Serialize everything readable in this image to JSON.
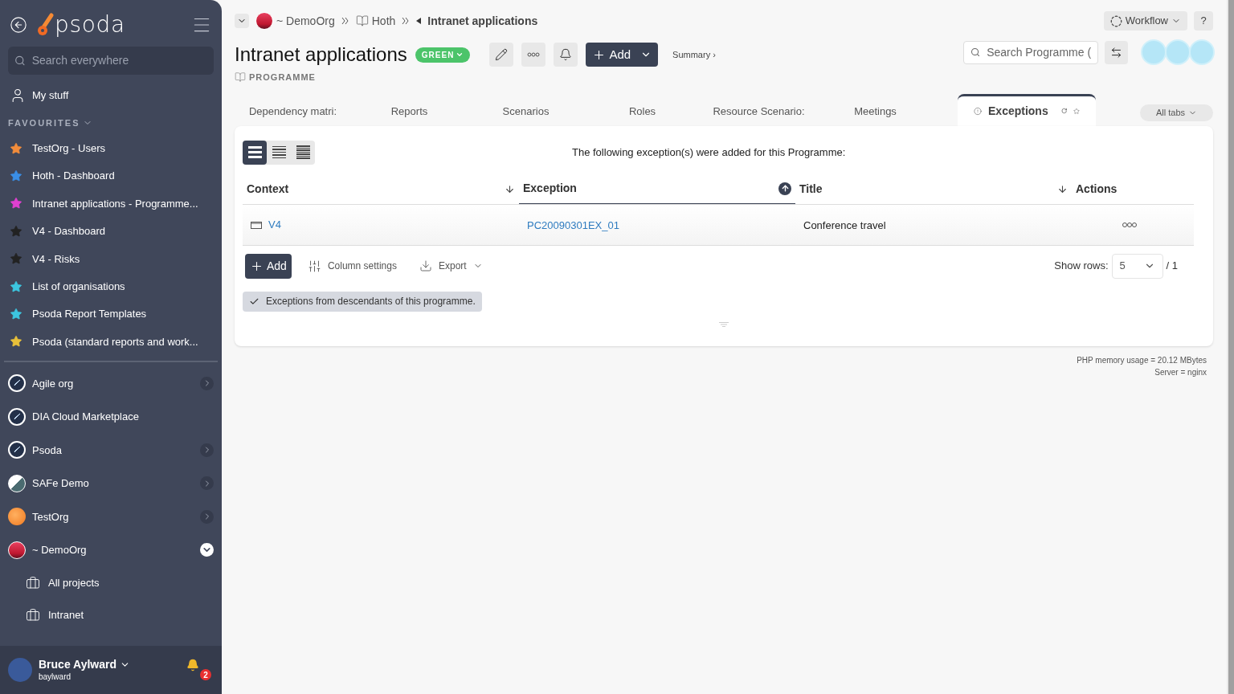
{
  "sidebar": {
    "logo": "psoda",
    "search_placeholder": "Search everywhere",
    "my_stuff": "My stuff",
    "favourites_heading": "FAVOURITES",
    "favourites": [
      {
        "label": "TestOrg - Users",
        "color": "#f28c3b"
      },
      {
        "label": "Hoth - Dashboard",
        "color": "#3a8ee6"
      },
      {
        "label": "Intranet applications - Programme...",
        "color": "#e040d0"
      },
      {
        "label": "V4 - Dashboard",
        "color": "#222222"
      },
      {
        "label": "V4 - Risks",
        "color": "#222222"
      },
      {
        "label": "List of organisations",
        "color": "#3cc6e0"
      },
      {
        "label": "Psoda Report Templates",
        "color": "#3cc6e0"
      },
      {
        "label": "Psoda (standard reports and work...",
        "color": "#e8c03a"
      }
    ],
    "orgs": [
      {
        "label": "Agile org",
        "kind": "rocket",
        "expanded": false
      },
      {
        "label": "DIA Cloud Marketplace",
        "kind": "rocket"
      },
      {
        "label": "Psoda",
        "kind": "rocket",
        "expanded": false
      },
      {
        "label": "SAFe Demo",
        "kind": "stripes",
        "expanded": false
      },
      {
        "label": "TestOrg",
        "kind": "sphere",
        "expanded": false
      },
      {
        "label": "~ DemoOrg",
        "kind": "sunset",
        "expanded": true,
        "children": [
          {
            "label": "All projects"
          },
          {
            "label": "Intranet"
          }
        ]
      }
    ],
    "user": {
      "name": "Bruce Aylward",
      "username": "baylward",
      "notifications": "2"
    }
  },
  "breadcrumb": [
    {
      "label": "~ DemoOrg",
      "kind": "org"
    },
    {
      "label": "Hoth",
      "kind": "book"
    },
    {
      "label": "Intranet applications",
      "kind": "current"
    }
  ],
  "header": {
    "title": "Intranet applications",
    "status": "GREEN",
    "add": "Add",
    "summary": "Summary ›",
    "type": "PROGRAMME",
    "workflow": "Workflow",
    "help": "?",
    "search_placeholder": "Search Programme ("
  },
  "tabs": [
    {
      "label": "Dependency matri:",
      "selected": false
    },
    {
      "label": "Reports",
      "selected": false
    },
    {
      "label": "Scenarios",
      "selected": false
    },
    {
      "label": "Roles",
      "selected": false
    },
    {
      "label": "Resource Scenario:",
      "selected": false
    },
    {
      "label": "Meetings",
      "selected": false
    },
    {
      "label": "Exceptions",
      "selected": true
    }
  ],
  "all_tabs": "All tabs",
  "views": [
    {
      "selected": true
    },
    {
      "selected": false
    },
    {
      "selected": false
    }
  ],
  "intro": "The following exception(s) were added for this Programme:",
  "table": {
    "columns": [
      {
        "label": "Context",
        "sortable": true,
        "selected": false
      },
      {
        "label": "Exception",
        "sortable": true,
        "selected": true
      },
      {
        "label": "Title",
        "sortable": true,
        "selected": false
      },
      {
        "label": "Actions",
        "sortable": false,
        "selected": false
      }
    ],
    "rows": [
      {
        "context": "V4",
        "exception": "PC20090301EX_01",
        "title": "Conference travel"
      }
    ]
  },
  "footer": {
    "add": "Add",
    "column_settings": "Column settings",
    "export": "Export",
    "show_rows": "Show rows:",
    "rows_value": "5",
    "pages": "/ 1"
  },
  "filter": {
    "label": "Exceptions from descendants of this programme.",
    "checked": true
  },
  "server_info": [
    "PHP memory usage = 20.12 MBytes",
    "Server = nginx"
  ]
}
